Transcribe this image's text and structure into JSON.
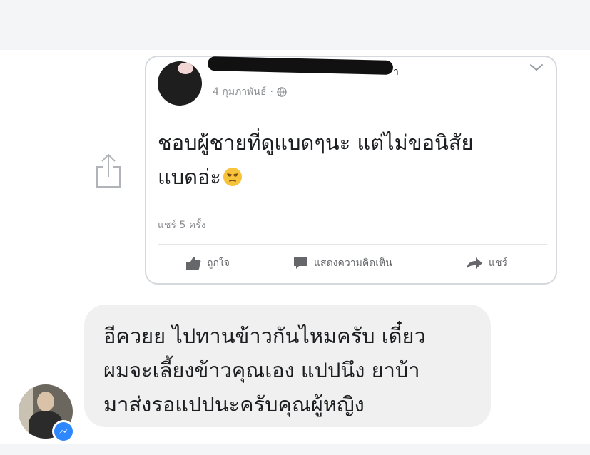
{
  "post": {
    "author_suffix": "า",
    "date": "4 กุมภาพันธ์",
    "separator": "·",
    "text_line1": "ชอบผู้ชายที่ดูแบดๆนะ แต่ไม่ขอนิสัย",
    "text_line2": "แบดอ่ะ",
    "share_count": "แชร์ 5 ครั้ง",
    "actions": {
      "like": "ถูกใจ",
      "comment": "แสดงความคิดเห็น",
      "share": "แชร์"
    }
  },
  "message": {
    "line1": "อีควยย ไปทานข้าวกันไหมครับ เดี๋ยว",
    "line2": "ผมจะเลี้ยงข้าวคุณเอง แปปนึง ยาบ้า",
    "line3": "มาส่งรอแปปนะครับคุณผู้หญิง"
  },
  "icons": {
    "share_side": "share-upload-icon",
    "chevron": "chevron-down-icon",
    "globe": "globe-icon",
    "emoji": "unamused-face-emoji",
    "like": "thumbs-up-icon",
    "comment": "comment-bubble-icon",
    "share": "share-arrow-icon",
    "messenger": "messenger-icon"
  },
  "colors": {
    "bubble": "#f1f0f0",
    "messenger_blue": "#2d88ff",
    "meta_gray": "#8a8d91",
    "text": "#1c1e21"
  }
}
